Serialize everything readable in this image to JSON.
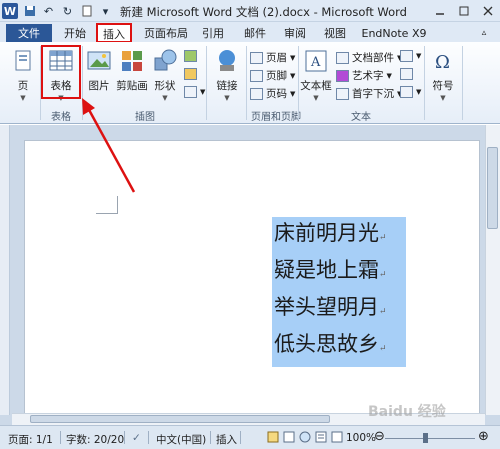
{
  "window": {
    "title": "新建 Microsoft Word 文档 (2).docx - Microsoft Word"
  },
  "tabs": [
    "文件",
    "开始",
    "插入",
    "页面布局",
    "引用",
    "邮件",
    "审阅",
    "视图",
    "EndNote X9"
  ],
  "ribbon": {
    "page_label": "页",
    "table_label": "表格",
    "group_tables": "表格",
    "picture_label": "图片",
    "clipart_label": "剪贴画",
    "shapes_label": "形状",
    "group_illustrations": "插图",
    "link_label": "链接",
    "header_label": "页眉",
    "footer_label": "页脚",
    "page_number_label": "页码",
    "group_header_footer": "页眉和页脚",
    "textbox_label": "文本框",
    "quickparts_label": "文档部件",
    "wordart_label": "艺术字",
    "dropcap_label": "首字下沉",
    "group_text": "文本",
    "symbol_label": "符号"
  },
  "document": {
    "lines": [
      "床前明月光",
      "疑是地上霜",
      "举头望明月",
      "低头思故乡"
    ],
    "paragraph_mark": "↵"
  },
  "status": {
    "page": "页面: 1/1",
    "words": "字数: 20/20",
    "language": "中文(中国)",
    "mode": "插入",
    "zoom": "100%"
  },
  "watermark": "Baidu 经验",
  "colors": {
    "accent": "#2b5797",
    "highlight": "#a7cff7",
    "annotation": "#dd1111"
  }
}
